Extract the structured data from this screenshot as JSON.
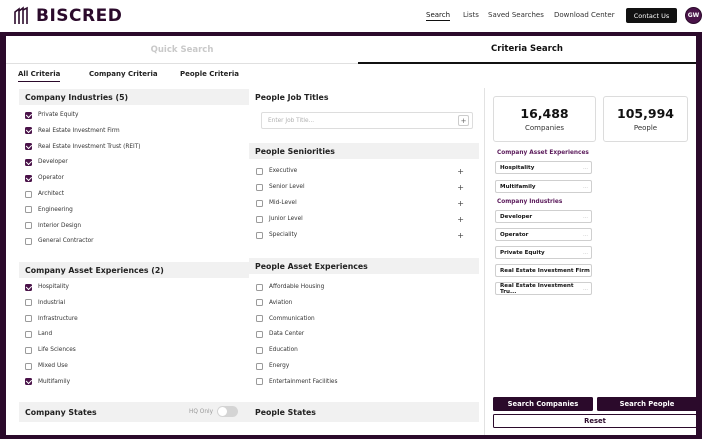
{
  "brand": {
    "name": "BISCRED",
    "color": "#2b0a2b",
    "accent": "#4a1349"
  },
  "nav": {
    "search": "Search",
    "lists": "Lists",
    "saved_searches": "Saved Searches",
    "download_center": "Download Center",
    "contact_us": "Contact Us",
    "avatar_initials": "GW"
  },
  "search_tabs": {
    "quick": "Quick Search",
    "criteria": "Criteria Search"
  },
  "sub_tabs": [
    "All Criteria",
    "Company Criteria",
    "People Criteria"
  ],
  "company_industries": {
    "title": "Company Industries (5)",
    "items": [
      {
        "label": "Private Equity",
        "checked": true
      },
      {
        "label": "Real Estate Investment Firm",
        "checked": true
      },
      {
        "label": "Real Estate Investment Trust (REIT)",
        "checked": true
      },
      {
        "label": "Developer",
        "checked": true
      },
      {
        "label": "Operator",
        "checked": true
      },
      {
        "label": "Architect",
        "checked": false
      },
      {
        "label": "Engineering",
        "checked": false
      },
      {
        "label": "Interior Design",
        "checked": false
      },
      {
        "label": "General Contractor",
        "checked": false
      }
    ]
  },
  "company_asset_experiences": {
    "title": "Company Asset Experiences (2)",
    "items": [
      {
        "label": "Hospitality",
        "checked": true
      },
      {
        "label": "Industrial",
        "checked": false
      },
      {
        "label": "Infrastructure",
        "checked": false
      },
      {
        "label": "Land",
        "checked": false
      },
      {
        "label": "Life Sciences",
        "checked": false
      },
      {
        "label": "Mixed Use",
        "checked": false
      },
      {
        "label": "Multifamily",
        "checked": true
      }
    ]
  },
  "company_states": {
    "title": "Company States",
    "hq_only": "HQ Only"
  },
  "people_job_titles": {
    "title": "People Job Titles",
    "placeholder": "Enter Job Title...",
    "add": "+"
  },
  "people_seniorities": {
    "title": "People Seniorities",
    "items": [
      "Executive",
      "Senior Level",
      "Mid-Level",
      "Junior Level",
      "Speciality"
    ]
  },
  "people_asset_experiences": {
    "title": "People Asset Experiences",
    "items": [
      "Affordable Housing",
      "Aviation",
      "Communication",
      "Data Center",
      "Education",
      "Energy",
      "Entertainment Facilities"
    ]
  },
  "people_states": {
    "title": "People States"
  },
  "summary": {
    "companies_count": "16,488",
    "companies_label": "Companies",
    "people_count": "105,994",
    "people_label": "People",
    "asset_group": "Company Asset Experiences",
    "asset_chips": [
      "Hospitality",
      "Multifamily"
    ],
    "industry_group": "Company Industries",
    "industry_chips": [
      "Developer",
      "Operator",
      "Private Equity",
      "Real Estate Investment Firm",
      "Real Estate Investment Tru..."
    ],
    "search_companies": "Search Companies",
    "search_people": "Search People",
    "reset": "Reset"
  }
}
